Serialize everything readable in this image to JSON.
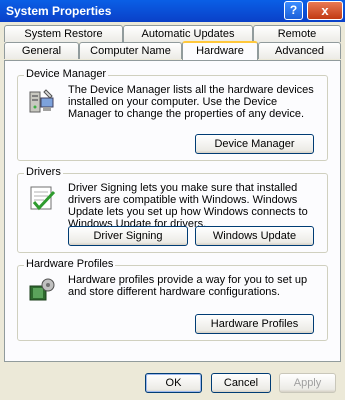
{
  "window": {
    "title": "System Properties"
  },
  "titlebar_buttons": {
    "help": "?",
    "close": "x"
  },
  "tabs": {
    "row_back": [
      "System Restore",
      "Automatic Updates",
      "Remote"
    ],
    "row_front": [
      "General",
      "Computer Name",
      "Hardware",
      "Advanced"
    ],
    "active": "Hardware"
  },
  "device_manager": {
    "title": "Device Manager",
    "text": "The Device Manager lists all the hardware devices installed on your computer. Use the Device Manager to change the properties of any device.",
    "button": "Device Manager",
    "icon": "device-manager-icon"
  },
  "drivers": {
    "title": "Drivers",
    "text": "Driver Signing lets you make sure that installed drivers are compatible with Windows. Windows Update lets you set up how Windows connects to Windows Update for drivers.",
    "signing_button": "Driver Signing",
    "update_button": "Windows Update",
    "icon": "driver-signing-icon"
  },
  "hardware_profiles": {
    "title": "Hardware Profiles",
    "text": "Hardware profiles provide a way for you to set up and store different hardware configurations.",
    "button": "Hardware Profiles",
    "icon": "hardware-profiles-icon"
  },
  "dialog_buttons": {
    "ok": "OK",
    "cancel": "Cancel",
    "apply": "Apply"
  },
  "colors": {
    "titlebar": "#0A5FE6",
    "face": "#ECE9D8",
    "active_tab_accent": "#FFC83C"
  }
}
